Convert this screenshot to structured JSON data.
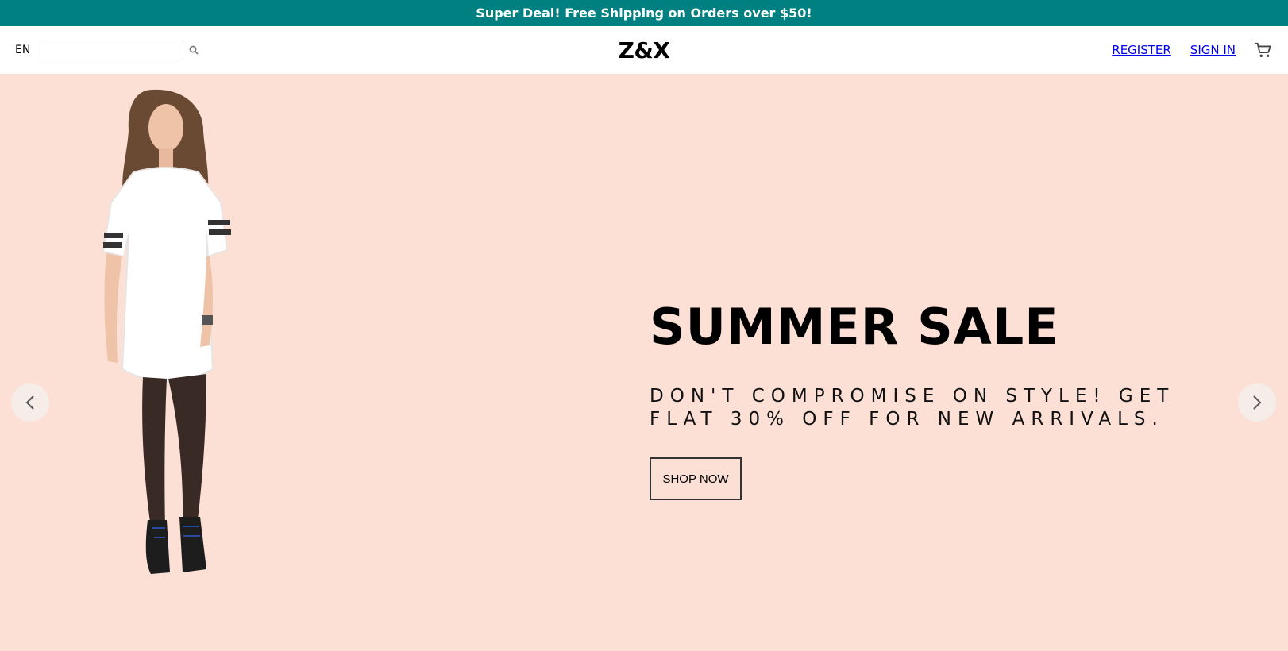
{
  "announcement": {
    "text": "Super Deal! Free Shipping on Orders over $50!"
  },
  "navbar": {
    "language": "EN",
    "search": {
      "value": "",
      "placeholder": ""
    },
    "logo": "Z&X",
    "register": "REGISTER",
    "sign_in": "SIGN IN",
    "icons": {
      "search": "search-icon",
      "cart": "cart-icon"
    }
  },
  "hero": {
    "title": "SUMMER SALE",
    "subtitle": "DON'T COMPROMISE ON STYLE! GET FLAT 30% OFF FOR NEW ARRIVALS.",
    "button": "SHOP NOW",
    "icons": {
      "prev": "chevron-left-icon",
      "next": "chevron-right-icon"
    }
  },
  "colors": {
    "announcement_bg": "#008080",
    "hero_bg": "#fce0d6",
    "link": "#0000ee"
  }
}
